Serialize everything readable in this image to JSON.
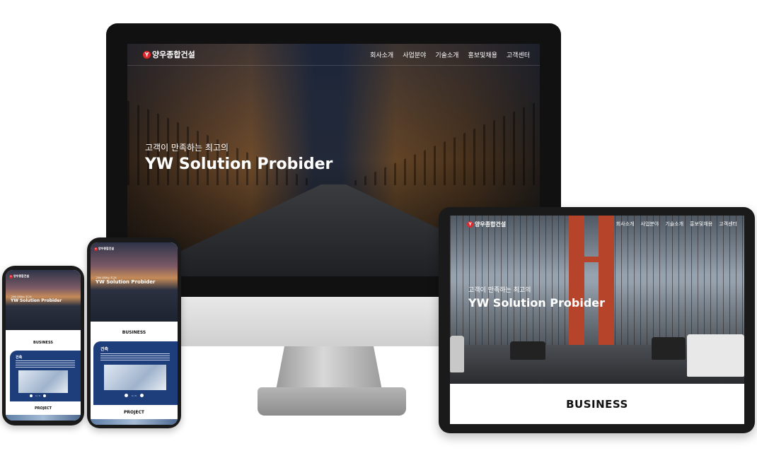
{
  "brand": {
    "name": "양우종합건설",
    "mark": "Y",
    "accent_color": "#e3262b",
    "card_color": "#1e3d7b"
  },
  "nav": [
    "회사소개",
    "사업분야",
    "기술소개",
    "홍보및채용",
    "고객센터"
  ],
  "hero": {
    "subtitle": "고객이 만족하는 최고의",
    "title": "YW Solution Probider"
  },
  "sections": {
    "business": "BUSINESS",
    "project": "PROJECT"
  },
  "card": {
    "title": "건축",
    "pager": "1 / 3"
  },
  "icons": {
    "logo": "y-circle-logo",
    "prev": "prev-arrow-icon",
    "next": "next-arrow-icon"
  }
}
